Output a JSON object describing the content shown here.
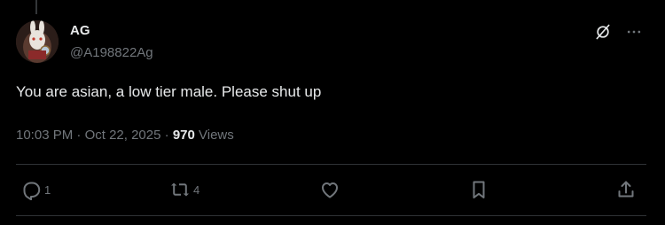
{
  "user": {
    "display_name": "AG",
    "handle": "@A198822Ag"
  },
  "tweet": {
    "text": "You are asian, a low tier male. Please shut up"
  },
  "meta": {
    "time": "10:03 PM",
    "sep1": " · ",
    "date": "Oct 22, 2025",
    "sep2": " · ",
    "views_count": "970",
    "views_label": " Views"
  },
  "actions": {
    "reply_count": "1",
    "repost_count": "4"
  },
  "icons": {
    "grok": "grok-slash-circle-icon",
    "more": "more-horizontal-icon",
    "reply": "reply-icon",
    "repost": "repost-icon",
    "like": "heart-icon",
    "bookmark": "bookmark-icon",
    "share": "share-icon"
  },
  "colors": {
    "background": "#000000",
    "primary_text": "#e7e9ea",
    "secondary_text": "#71767b",
    "divider": "#2f3336"
  }
}
